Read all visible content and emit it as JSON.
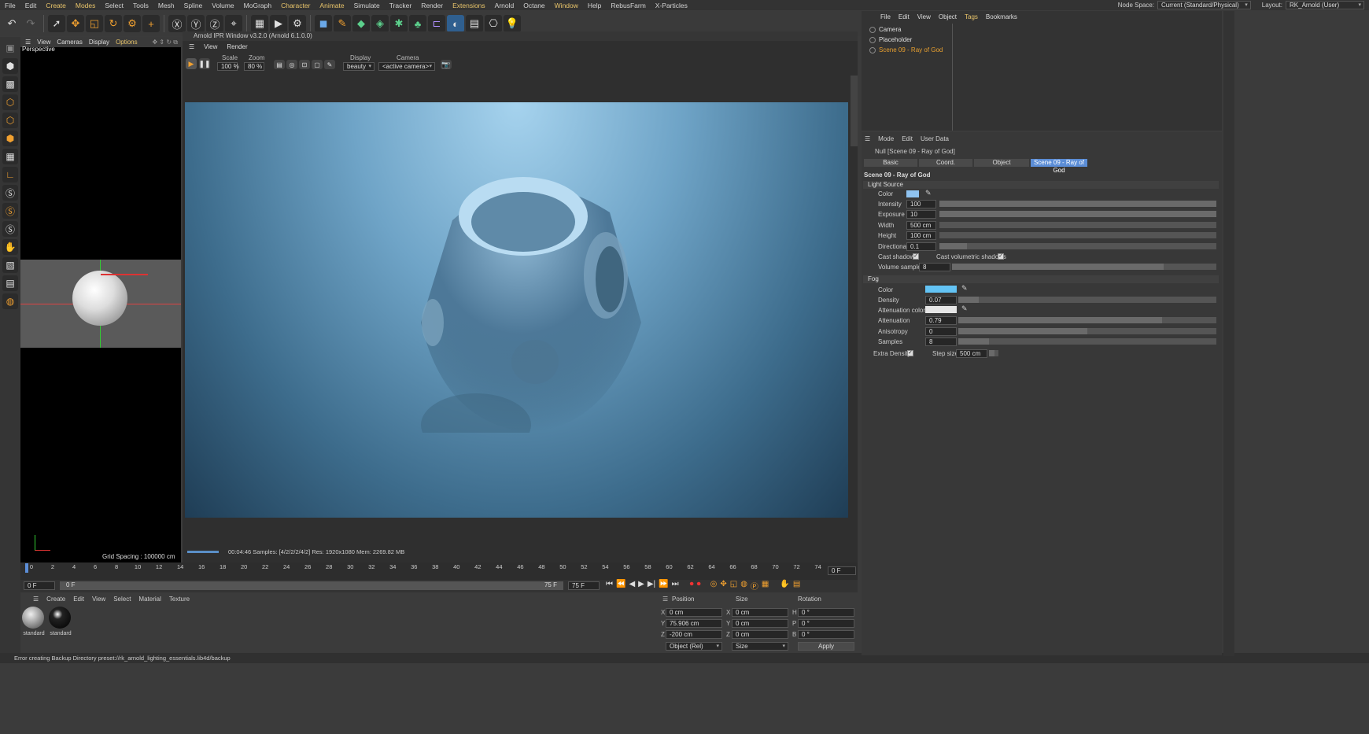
{
  "menu": [
    "File",
    "Edit",
    "Create",
    "Modes",
    "Select",
    "Tools",
    "Mesh",
    "Spline",
    "Volume",
    "MoGraph",
    "Character",
    "Animate",
    "Simulate",
    "Tracker",
    "Render",
    "Extensions",
    "Arnold",
    "Octane",
    "Window",
    "Help",
    "RebusFarm",
    "X-Particles"
  ],
  "node_space_label": "Node Space:",
  "node_space_value": "Current (Standard/Physical)",
  "layout_label": "Layout:",
  "layout_value": "RK_Arnold (User)",
  "viewport": {
    "menu": [
      "View",
      "Cameras",
      "Display",
      "Options"
    ],
    "label": "Perspective",
    "grid": "Grid Spacing : 100000 cm"
  },
  "ipr": {
    "title": "Arnold IPR Window v3.2.0 (Arnold 6.1.0.0)",
    "menu": [
      "View",
      "Render"
    ],
    "scale_label": "Scale",
    "scale": "100 %",
    "zoom_label": "Zoom",
    "zoom": "80 %",
    "display_label": "Display",
    "display": "beauty",
    "camera_label": "Camera",
    "camera": "<active camera>",
    "status": "00:04:46  Samples: [4/2/2/2/4/2]  Res: 1920x1080  Mem: 2269.82 MB"
  },
  "timeline": {
    "ticks": [
      "0",
      "2",
      "4",
      "6",
      "8",
      "10",
      "12",
      "14",
      "16",
      "18",
      "20",
      "22",
      "24",
      "26",
      "28",
      "30",
      "32",
      "34",
      "36",
      "38",
      "40",
      "42",
      "44",
      "46",
      "48",
      "50",
      "52",
      "54",
      "56",
      "58",
      "60",
      "62",
      "64",
      "66",
      "68",
      "70",
      "72",
      "74"
    ],
    "frame": "0 F",
    "start": "0 F",
    "startfield": "0 F",
    "end": "75 F",
    "endfield": "75 F"
  },
  "materials": {
    "menu": [
      "Create",
      "Edit",
      "View",
      "Select",
      "Material",
      "Texture"
    ],
    "items": [
      "standard",
      "standard"
    ]
  },
  "coords": {
    "position": "Position",
    "size": "Size",
    "rotation": "Rotation",
    "px": "0 cm",
    "py": "75.906 cm",
    "pz": "-200 cm",
    "sx": "0 cm",
    "sy": "0 cm",
    "sz": "0 cm",
    "h": "0 °",
    "p": "0 °",
    "b": "0 °",
    "mode": "Object (Rel)",
    "sizemode": "Size",
    "apply": "Apply",
    "xl": "X",
    "yl": "Y",
    "zl": "Z",
    "hl": "H",
    "pl": "P",
    "bl": "B"
  },
  "status": "Error creating Backup Directory preset://rk_arnold_lighting_essentials.lib4d/backup",
  "objects": {
    "menu": [
      "File",
      "Edit",
      "View",
      "Object",
      "Tags",
      "Bookmarks"
    ],
    "items": [
      "Camera",
      "Placeholder",
      "Scene 09 - Ray of God"
    ]
  },
  "attributes": {
    "menu": [
      "Mode",
      "Edit",
      "User Data"
    ],
    "header": "Null [Scene 09 - Ray of God]",
    "tabs": [
      "Basic",
      "Coord.",
      "Object",
      "Scene 09 - Ray of God"
    ],
    "title": "Scene 09 - Ray of God",
    "light_section": "Light Source",
    "fog_section": "Fog",
    "light": [
      {
        "label": "Intensity",
        "value": "100"
      },
      {
        "label": "Exposure",
        "value": "10"
      },
      {
        "label": "Width",
        "value": "500 cm"
      },
      {
        "label": "Height",
        "value": "100 cm"
      },
      {
        "label": "Directional",
        "value": "0.1"
      }
    ],
    "color_label": "Color",
    "cast_shadows": "Cast shadows",
    "cast_vol": "Cast volumetric shadows",
    "volume_samples_label": "Volume samples",
    "volume_samples": "8",
    "fog": [
      {
        "label": "Density",
        "value": "0.07"
      },
      {
        "label": "Attenuation color",
        "value": ""
      },
      {
        "label": "Attenuation",
        "value": "0.79"
      },
      {
        "label": "Anisotropy",
        "value": "0"
      },
      {
        "label": "Samples",
        "value": "8"
      }
    ],
    "extra_density": "Extra Density",
    "step_label": "Step size",
    "step": "500 cm"
  },
  "colors": {
    "light_color": "#8fc3f0",
    "fog_color": "#63c3f4",
    "atten_color": "#e6e6e6",
    "accent": "#5b8dd6"
  }
}
